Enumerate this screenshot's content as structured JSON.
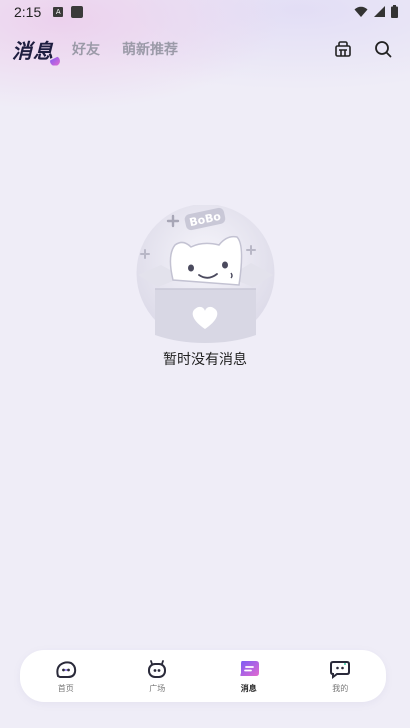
{
  "status_bar": {
    "time": "2:15",
    "app_icon_letter": "A"
  },
  "top_nav": {
    "active_tab": "消息",
    "tabs": [
      "好友",
      "萌新推荐"
    ]
  },
  "empty_state": {
    "badge_text": "BoBo",
    "message": "暂时没有消息"
  },
  "bottom_nav": {
    "items": [
      {
        "label": "首页",
        "icon": "home-face-icon"
      },
      {
        "label": "广场",
        "icon": "plaza-robot-icon"
      },
      {
        "label": "消息",
        "icon": "message-bubble-icon"
      },
      {
        "label": "我的",
        "icon": "profile-bubble-icon"
      }
    ],
    "active_index": 2
  },
  "colors": {
    "accent_start": "#7a5cf5",
    "accent_end": "#e36ad0",
    "nav_text": "#1e1e40",
    "inactive_tab": "#9b9aa8",
    "background": "#efedf7"
  }
}
